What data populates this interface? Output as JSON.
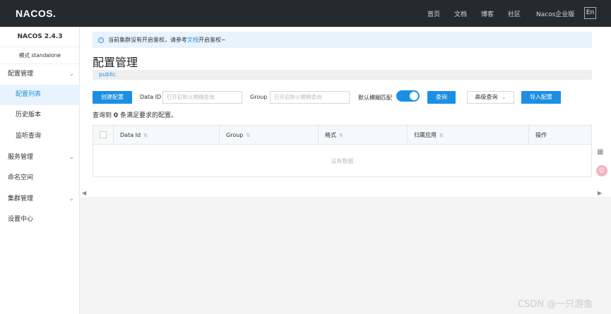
{
  "header": {
    "logo": "NACOS.",
    "nav": [
      "首页",
      "文档",
      "博客",
      "社区",
      "Nacos企业版"
    ],
    "lang": "En"
  },
  "sidebar": {
    "version": "NACOS 2.4.3",
    "mode": "模式 standalone",
    "items": [
      {
        "label": "配置管理",
        "expandable": true
      },
      {
        "label": "配置列表",
        "active": true
      },
      {
        "label": "历史版本"
      },
      {
        "label": "监听查询"
      },
      {
        "label": "服务管理",
        "expandable": true
      },
      {
        "label": "命名空间"
      },
      {
        "label": "集群管理",
        "expandable": true
      },
      {
        "label": "设置中心"
      }
    ]
  },
  "notice": {
    "prefix": "当前集群没有开启鉴权，请参考",
    "link": "文档",
    "suffix": "开启鉴权~"
  },
  "page": {
    "title": "配置管理",
    "namespace": "public"
  },
  "toolbar": {
    "create_label": "创建配置",
    "dataid_label": "Data ID",
    "dataid_placeholder": "已开启默认模糊查询",
    "group_label": "Group",
    "group_placeholder": "已开启默认模糊查询",
    "fuzzy_label": "默认模糊匹配",
    "fuzzy_on": true,
    "query_label": "查询",
    "advanced_label": "高级查询",
    "import_label": "导入配置"
  },
  "result": {
    "prefix": "查询到",
    "count": "0",
    "suffix": "条满足要求的配置。"
  },
  "table": {
    "columns": [
      "Data Id",
      "Group",
      "格式",
      "归属应用",
      "操作"
    ],
    "empty_text": "没有数据"
  },
  "watermark": "CSDN @一只游鱼",
  "colors": {
    "topbar": "#252a2f",
    "primary": "#1a8fe3",
    "notice_bg": "#e8f3fd"
  }
}
